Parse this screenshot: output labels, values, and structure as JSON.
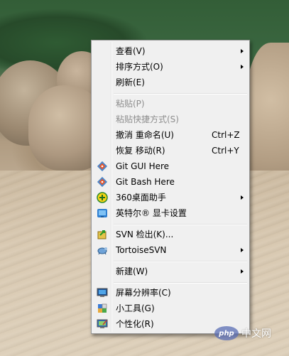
{
  "menu": {
    "items": [
      {
        "label": "查看(V)",
        "submenu": true
      },
      {
        "label": "排序方式(O)",
        "submenu": true
      },
      {
        "label": "刷新(E)"
      },
      {
        "label": "粘贴(P)",
        "disabled": true
      },
      {
        "label": "粘贴快捷方式(S)",
        "disabled": true
      },
      {
        "label": "撤消 重命名(U)",
        "shortcut": "Ctrl+Z"
      },
      {
        "label": "恢复 移动(R)",
        "shortcut": "Ctrl+Y"
      },
      {
        "label": "Git GUI Here",
        "icon": "git-icon"
      },
      {
        "label": "Git Bash Here",
        "icon": "git-icon"
      },
      {
        "label": "360桌面助手",
        "icon": "360-assistant-icon",
        "submenu": true
      },
      {
        "label": "英特尔® 显卡设置",
        "icon": "intel-graphics-icon"
      },
      {
        "label": "SVN 检出(K)...",
        "icon": "svn-checkout-icon"
      },
      {
        "label": "TortoiseSVN",
        "icon": "tortoisesvn-icon",
        "submenu": true
      },
      {
        "label": "新建(W)",
        "submenu": true
      },
      {
        "label": "屏幕分辨率(C)",
        "icon": "screen-resolution-icon"
      },
      {
        "label": "小工具(G)",
        "icon": "gadgets-icon"
      },
      {
        "label": "个性化(R)",
        "icon": "personalize-icon"
      }
    ]
  },
  "watermark": {
    "badge": "php",
    "text": "中文网"
  },
  "colors": {
    "menu_bg": "#f0f0f0",
    "menu_border": "#979797",
    "disabled_text": "#8d8d8d"
  }
}
